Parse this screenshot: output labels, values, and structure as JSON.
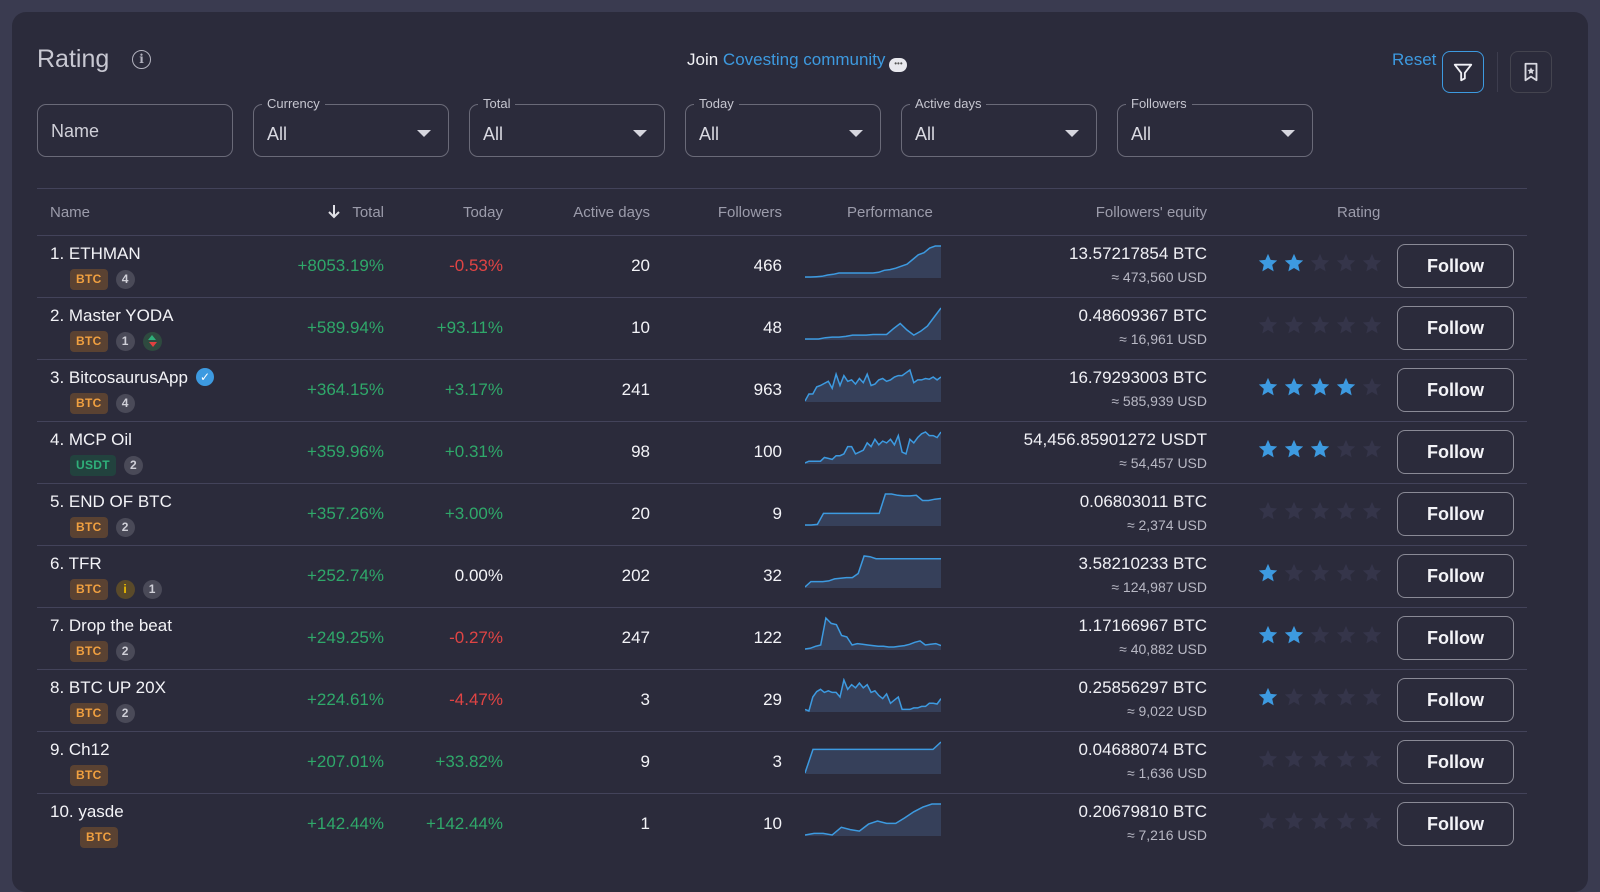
{
  "header": {
    "title": "Rating",
    "join_prefix": "Join",
    "join_link": "Covesting community",
    "reset_label": "Reset"
  },
  "filters": {
    "name_placeholder": "Name",
    "selects": [
      {
        "label": "Currency",
        "value": "All"
      },
      {
        "label": "Total",
        "value": "All"
      },
      {
        "label": "Today",
        "value": "All"
      },
      {
        "label": "Active days",
        "value": "All"
      },
      {
        "label": "Followers",
        "value": "All"
      }
    ]
  },
  "columns": {
    "name": "Name",
    "total": "Total",
    "today": "Today",
    "active_days": "Active days",
    "followers": "Followers",
    "performance": "Performance",
    "equity": "Followers' equity",
    "rating": "Rating"
  },
  "colors": {
    "accent": "#3d9ae0",
    "positive": "#2fa86a",
    "negative": "#e04444",
    "star_on": "#3d9ae0",
    "star_off": "#35354a"
  },
  "follow_label": "Follow",
  "rows": [
    {
      "name": "1. ETHMAN",
      "currency": "BTC",
      "count": "4",
      "extra": "",
      "verified": false,
      "total": "+8053.19%",
      "today": "-0.53%",
      "today_sign": "neg",
      "active_days": "20",
      "followers": "466",
      "equity": "13.57217854 BTC",
      "equity_usd": "≈ 473,560 USD",
      "rating": 2,
      "perf": [
        2,
        2,
        2.5,
        3,
        5,
        6,
        8,
        8,
        8,
        8,
        8,
        8,
        8,
        9,
        12,
        13,
        15,
        18,
        21,
        28,
        35,
        38,
        45,
        48,
        48
      ]
    },
    {
      "name": "2. Master YODA",
      "currency": "BTC",
      "count": "1",
      "extra": "updown",
      "verified": false,
      "total": "+589.94%",
      "today": "+93.11%",
      "today_sign": "pos",
      "active_days": "10",
      "followers": "48",
      "equity": "0.48609367 BTC",
      "equity_usd": "≈ 16,961 USD",
      "rating": 0,
      "perf": [
        2,
        2,
        2,
        4,
        5,
        5,
        6,
        8,
        8,
        8,
        9,
        9,
        9,
        18,
        26,
        16,
        8,
        14,
        22,
        36,
        50
      ]
    },
    {
      "name": "3. BitcosaurusApp",
      "currency": "BTC",
      "count": "4",
      "extra": "",
      "verified": true,
      "total": "+364.15%",
      "today": "+3.17%",
      "today_sign": "pos",
      "active_days": "241",
      "followers": "963",
      "equity": "16.79293003 BTC",
      "equity_usd": "≈ 585,939 USD",
      "rating": 4,
      "perf": [
        0,
        10,
        10,
        20,
        22,
        25,
        28,
        18,
        38,
        22,
        36,
        28,
        30,
        24,
        32,
        26,
        38,
        22,
        24,
        30,
        32,
        28,
        30,
        34,
        36,
        36,
        40,
        44,
        26,
        30,
        30,
        32,
        31,
        34,
        30,
        34
      ]
    },
    {
      "name": "4. MCP Oil",
      "currency": "USDT",
      "count": "2",
      "extra": "",
      "verified": false,
      "total": "+359.96%",
      "today": "+0.31%",
      "today_sign": "pos",
      "active_days": "98",
      "followers": "100",
      "equity": "54,456.85901272 USDT",
      "equity_usd": "≈ 54,457 USD",
      "rating": 3,
      "perf": [
        0,
        2,
        2,
        2,
        2,
        6,
        5,
        4,
        8,
        8,
        10,
        18,
        18,
        10,
        12,
        14,
        22,
        18,
        26,
        20,
        24,
        22,
        26,
        20,
        30,
        12,
        10,
        26,
        22,
        28,
        32,
        34,
        30,
        30,
        28,
        34
      ]
    },
    {
      "name": "5. END OF BTC",
      "currency": "BTC",
      "count": "2",
      "extra": "",
      "verified": false,
      "total": "+357.26%",
      "today": "+3.00%",
      "today_sign": "pos",
      "active_days": "20",
      "followers": "9",
      "equity": "0.06803011 BTC",
      "equity_usd": "≈ 2,374 USD",
      "rating": 0,
      "perf": [
        2,
        2,
        3,
        20,
        20,
        20,
        20,
        20,
        20,
        20,
        20,
        20,
        20,
        50,
        50,
        48,
        47,
        47,
        48,
        40,
        40,
        42,
        43
      ]
    },
    {
      "name": "6. TFR",
      "currency": "BTC",
      "count": "1",
      "extra": "warning",
      "verified": false,
      "total": "+252.74%",
      "today": "0.00%",
      "today_sign": "neu",
      "active_days": "202",
      "followers": "32",
      "equity": "3.58210233 BTC",
      "equity_usd": "≈ 124,987 USD",
      "rating": 1,
      "perf": [
        0,
        8,
        8,
        8,
        9,
        12,
        13,
        14,
        14,
        20,
        46,
        45,
        42,
        42,
        42,
        42,
        42,
        42,
        42,
        42,
        42,
        42,
        42,
        42
      ]
    },
    {
      "name": "7. Drop the beat",
      "currency": "BTC",
      "count": "2",
      "extra": "",
      "verified": false,
      "total": "+249.25%",
      "today": "-0.27%",
      "today_sign": "neg",
      "active_days": "247",
      "followers": "122",
      "equity": "1.17166967 BTC",
      "equity_usd": "≈ 40,882 USD",
      "rating": 2,
      "perf": [
        2,
        3,
        6,
        8,
        48,
        40,
        38,
        22,
        20,
        8,
        10,
        9,
        8,
        7,
        6,
        6,
        5,
        5,
        6,
        7,
        9,
        12,
        14,
        8,
        9,
        10,
        7
      ]
    },
    {
      "name": "8. BTC UP 20X",
      "currency": "BTC",
      "count": "2",
      "extra": "",
      "verified": false,
      "total": "+224.61%",
      "today": "-4.47%",
      "today_sign": "neg",
      "active_days": "3",
      "followers": "29",
      "equity": "0.25856297 BTC",
      "equity_usd": "≈ 9,022 USD",
      "rating": 1,
      "perf": [
        2,
        0,
        18,
        25,
        28,
        24,
        26,
        24,
        24,
        18,
        40,
        28,
        34,
        30,
        36,
        30,
        34,
        24,
        26,
        20,
        16,
        22,
        10,
        14,
        18,
        2,
        2,
        2,
        4,
        4,
        6,
        6,
        10,
        10,
        9,
        16
      ]
    },
    {
      "name": "9. Ch12",
      "currency": "BTC",
      "count": "",
      "extra": "",
      "verified": false,
      "total": "+207.01%",
      "today": "+33.82%",
      "today_sign": "pos",
      "active_days": "9",
      "followers": "3",
      "equity": "0.04688074 BTC",
      "equity_usd": "≈ 1,636 USD",
      "rating": 0,
      "perf": [
        0,
        38,
        38,
        38,
        38,
        38,
        38,
        38,
        38,
        38,
        38,
        38,
        38,
        38,
        38,
        38,
        38,
        50
      ]
    },
    {
      "name": "10. yasde",
      "currency": "BTC",
      "count": "",
      "extra": "",
      "verified": false,
      "total": "+142.44%",
      "today": "+142.44%",
      "today_sign": "pos",
      "active_days": "1",
      "followers": "10",
      "equity": "0.20679810 BTC",
      "equity_usd": "≈ 7,216 USD",
      "rating": 0,
      "perf": [
        0,
        2,
        2,
        0,
        10,
        7,
        5,
        14,
        18,
        15,
        15,
        22,
        30,
        36,
        40,
        40
      ]
    }
  ]
}
